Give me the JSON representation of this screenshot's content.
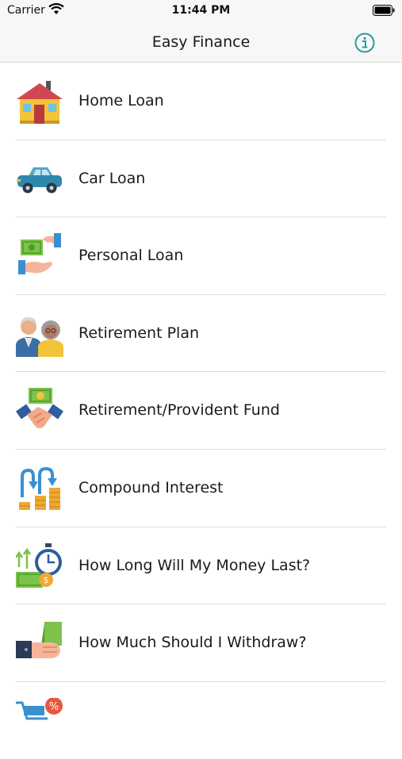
{
  "status_bar": {
    "carrier": "Carrier",
    "time": "11:44 PM"
  },
  "nav": {
    "title": "Easy Finance",
    "info_icon": "info-icon"
  },
  "colors": {
    "accent": "#2a9d9f"
  },
  "items": [
    {
      "label": "Home Loan",
      "icon": "house-icon"
    },
    {
      "label": "Car Loan",
      "icon": "car-icon"
    },
    {
      "label": "Personal Loan",
      "icon": "cash-hand-icon"
    },
    {
      "label": "Retirement Plan",
      "icon": "elderly-couple-icon"
    },
    {
      "label": "Retirement/Provident Fund",
      "icon": "handshake-money-icon"
    },
    {
      "label": "Compound Interest",
      "icon": "coins-growth-icon"
    },
    {
      "label": "How Long Will My Money Last?",
      "icon": "stopwatch-money-icon"
    },
    {
      "label": "How Much Should I Withdraw?",
      "icon": "hand-cash-icon"
    },
    {
      "label": "",
      "icon": "shopping-cart-discount-icon"
    }
  ]
}
